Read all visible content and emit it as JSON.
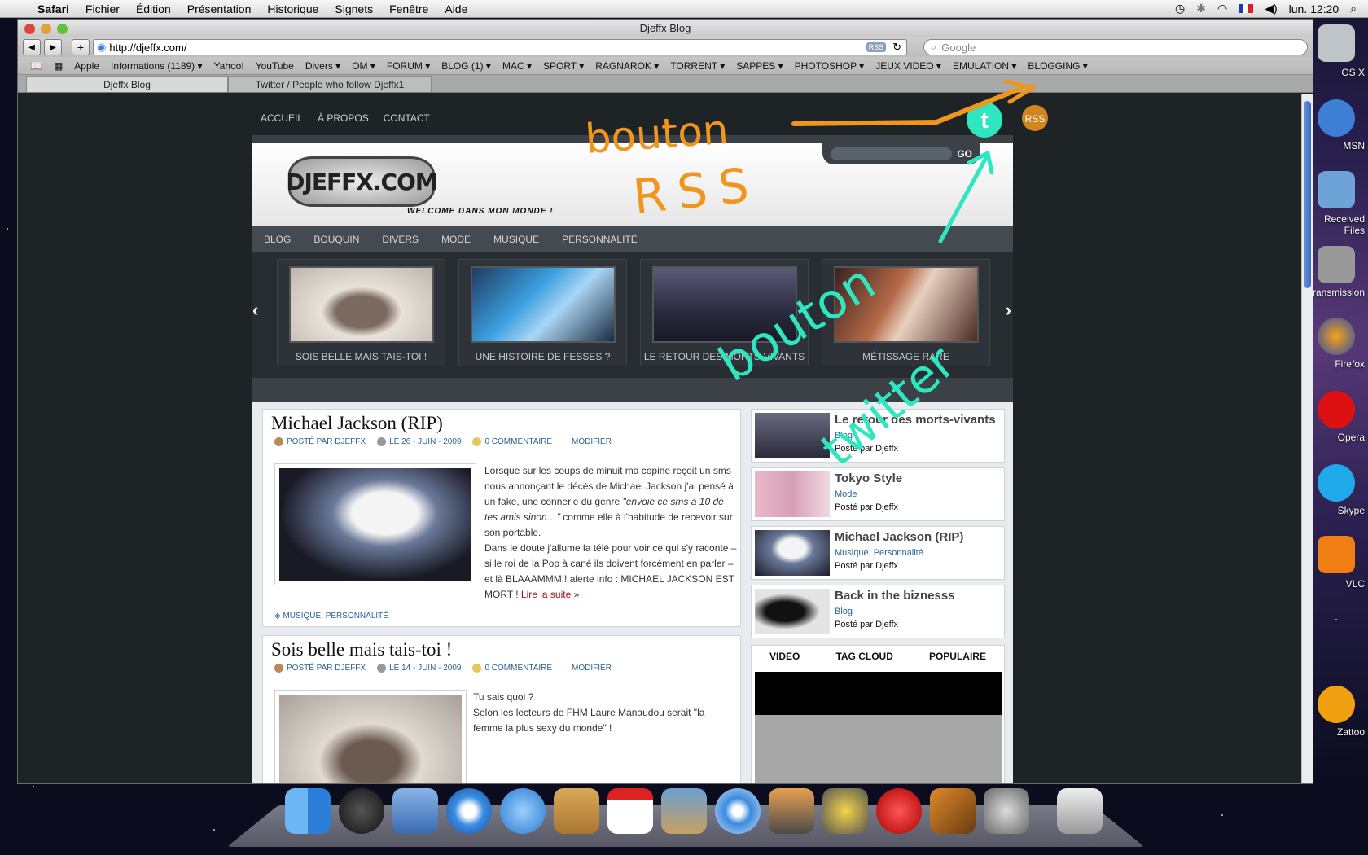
{
  "menubar": {
    "app": "Safari",
    "items": [
      "Fichier",
      "Édition",
      "Présentation",
      "Historique",
      "Signets",
      "Fenêtre",
      "Aide"
    ],
    "clock": "lun. 12:20"
  },
  "window": {
    "title": "Djeffx Blog",
    "url": "http://djeffx.com/",
    "rss_badge": "RSS",
    "search_placeholder": "Google",
    "bookmarks": [
      "Apple",
      "Informations (1189) ▾",
      "Yahoo!",
      "YouTube",
      "Divers ▾",
      "OM ▾",
      "FORUM ▾",
      "BLOG (1) ▾",
      "MAC ▾",
      "SPORT ▾",
      "RAGNAROK ▾",
      "TORRENT ▾",
      "SAPPES ▾",
      "PHOTOSHOP ▾",
      "JEUX VIDEO ▾",
      "EMULATION ▾",
      "BLOGGING ▾"
    ],
    "tabs": [
      {
        "label": "Djeffx Blog",
        "active": true
      },
      {
        "label": "Twitter / People who follow Djeffx1",
        "active": false
      }
    ]
  },
  "site": {
    "topnav": [
      "ACCUEIL",
      "À PROPOS",
      "CONTACT"
    ],
    "logo_text": "DJEFFX.COM",
    "tagline": "WELCOME DANS MON MONDE !",
    "search_go": "GO",
    "categories": [
      "BLOG",
      "BOUQUIN",
      "DIVERS",
      "MODE",
      "MUSIQUE",
      "PERSONNALITÉ"
    ],
    "slides": [
      {
        "caption": "SOIS BELLE MAIS TAIS-TOI !"
      },
      {
        "caption": "UNE HISTOIRE DE FESSES ?"
      },
      {
        "caption": "LE RETOUR DES MORTS-VIVANTS"
      },
      {
        "caption": "MÉTISSAGE RARE"
      }
    ],
    "posts": [
      {
        "title": "Michael Jackson (RIP)",
        "author": "POSTÉ PAR DJEFFX",
        "date": "LE 26 - JUIN - 2009",
        "comments": "0 COMMENTAIRE",
        "edit": "MODIFIER",
        "body1": "Lorsque sur les coups de minuit ma copine reçoit un sms nous annonçant le décès de Michael Jackson j'ai pensé à un fake, une connerie du genre ",
        "body_italic": "\"envoie ce sms à 10 de tes amis sinon…\"",
        "body2": " comme elle à l'habitude de recevoir sur son portable.",
        "body3": "Dans le doute j'allume la télé pour voir ce qui s'y raconte – si le roi de la Pop à cané ils doivent forcément en parler – et là BLAAAMMM!! alerte info : MICHAEL JACKSON EST MORT ! ",
        "read_more": "Lire la suite »",
        "tags": "MUSIQUE, PERSONNALITÉ"
      },
      {
        "title": "Sois belle mais tais-toi !",
        "author": "POSTÉ PAR DJEFFX",
        "date": "LE 14 - JUIN - 2009",
        "comments": "0 COMMENTAIRE",
        "edit": "MODIFIER",
        "line1": "Tu sais quoi ?",
        "line2": "Selon les lecteurs de FHM Laure Manaudou serait \"la femme la plus sexy du monde\" !"
      }
    ],
    "sidebar": [
      {
        "title": "Le retour des morts-vivants",
        "category": "Blog",
        "author": "Posté par Djeffx"
      },
      {
        "title": "Tokyo Style",
        "category": "Mode",
        "author": "Posté par Djeffx"
      },
      {
        "title": "Michael Jackson (RIP)",
        "category": "Musique, Personnalité",
        "author": "Posté par Djeffx"
      },
      {
        "title": "Back in the biznesss",
        "category": "Blog",
        "author": "Posté par Djeffx"
      }
    ],
    "widget_tabs": [
      "VIDEO",
      "TAG CLOUD",
      "POPULAIRE"
    ],
    "rss_icon_text": "RSS",
    "twitter_icon_text": "t"
  },
  "annotations": {
    "rss_note_line1": "bouton",
    "rss_note_line2": "RSS",
    "twitter_note_line1": "bouton",
    "twitter_note_line2": "twitter",
    "orange": "#f0961e",
    "cyan": "#2ee6c0"
  },
  "right_dock": [
    "OS X",
    "MSN",
    "Received Files",
    "Transmission",
    "Firefox",
    "Opera",
    "Skype",
    "VLC",
    "Zattoo"
  ]
}
